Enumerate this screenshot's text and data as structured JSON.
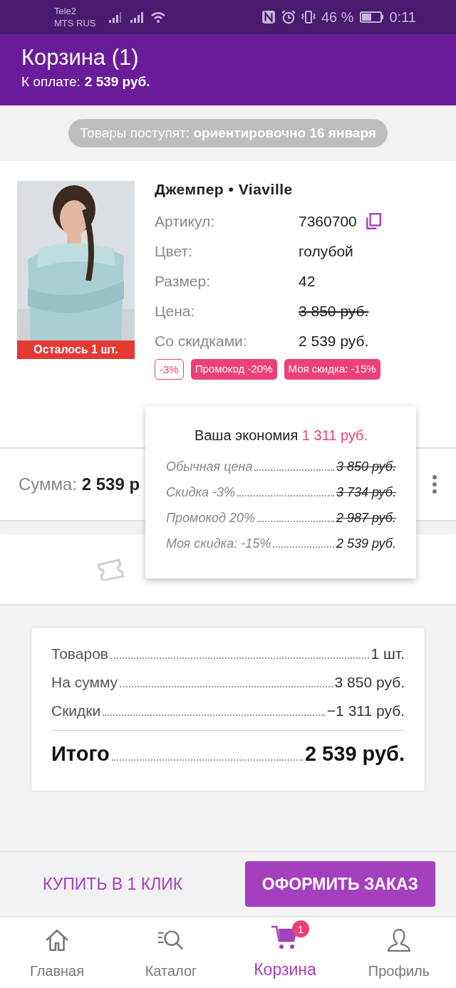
{
  "status_bar": {
    "carrier_1": "Tele2",
    "carrier_2": "MTS RUS",
    "battery": "46 %",
    "time": "0:11"
  },
  "header": {
    "title": "Корзина (1)",
    "to_pay_label": "К оплате:",
    "to_pay_value": "2 539 руб."
  },
  "delivery_note": "Товары поступят: **ориентировочно 16 января**",
  "product": {
    "name": "Джемпер • Viaville",
    "stock_badge": "Осталось 1 шт.",
    "attributes": [
      {
        "label": "Артикул:",
        "value": "7360700",
        "kind": "copy"
      },
      {
        "label": "Цвет:",
        "value": "голубой",
        "kind": "plain"
      },
      {
        "label": "Размер:",
        "value": "42",
        "kind": "plain"
      },
      {
        "label": "Цена:",
        "value": "3 850 руб.",
        "kind": "strike"
      },
      {
        "label": "Со скидками:",
        "value": "2 539 руб.",
        "kind": "plain"
      }
    ],
    "tags": [
      {
        "label": "-3%",
        "kind": "outline"
      },
      {
        "label": "Промокод -20%",
        "kind": "filled"
      },
      {
        "label": "Моя скидка: -15%",
        "kind": "filled"
      }
    ]
  },
  "sum": {
    "label": "Сумма:",
    "value": "2 539 р"
  },
  "savings": {
    "title": "Ваша экономия",
    "amount": "1 311 руб.",
    "lines": [
      {
        "label": "Обычная цена",
        "value": "3 850 руб.",
        "struck": true
      },
      {
        "label": "Скидка -3%",
        "value": "3 734 руб.",
        "struck": true
      },
      {
        "label": "Промокод 20%",
        "value": "2 987 руб.",
        "struck": true
      },
      {
        "label": "Моя скидка: -15%",
        "value": "2 539 руб.",
        "struck": false
      }
    ]
  },
  "summary": {
    "rows": [
      {
        "label": "Товаров",
        "value": "1 шт."
      },
      {
        "label": "На сумму",
        "value": "3 850 руб."
      },
      {
        "label": "Скидки",
        "value": "−1 311 руб."
      }
    ],
    "total": {
      "label": "Итого",
      "value": "2 539 руб."
    }
  },
  "actions": {
    "buy_one_click": "КУПИТЬ В 1 КЛИК",
    "checkout": "ОФОРМИТЬ ЗАКАЗ"
  },
  "nav": [
    {
      "label": "Главная",
      "kind": "home",
      "selected": false
    },
    {
      "label": "Каталог",
      "kind": "catalog",
      "selected": false
    },
    {
      "label": "Корзина",
      "kind": "cart",
      "selected": true,
      "badge": "1"
    },
    {
      "label": "Профиль",
      "kind": "profile",
      "selected": false
    }
  ]
}
